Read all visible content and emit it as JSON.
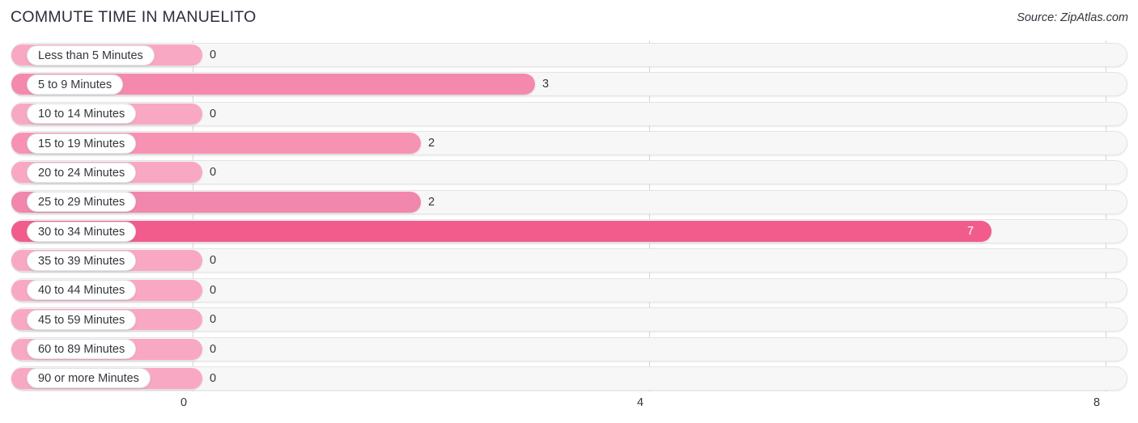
{
  "header": {
    "title": "COMMUTE TIME IN MANUELITO",
    "source": "Source: ZipAtlas.com"
  },
  "chart_data": {
    "type": "bar",
    "orientation": "horizontal",
    "title": "COMMUTE TIME IN MANUELITO",
    "xlabel": "",
    "ylabel": "",
    "xlim": [
      0,
      8
    ],
    "ticks": [
      "0",
      "4",
      "8"
    ],
    "tick_values": [
      0,
      4,
      8
    ],
    "grid": true,
    "legend": false,
    "categories": [
      "Less than 5 Minutes",
      "5 to 9 Minutes",
      "10 to 14 Minutes",
      "15 to 19 Minutes",
      "20 to 24 Minutes",
      "25 to 29 Minutes",
      "30 to 34 Minutes",
      "35 to 39 Minutes",
      "40 to 44 Minutes",
      "45 to 59 Minutes",
      "60 to 89 Minutes",
      "90 or more Minutes"
    ],
    "values": [
      0,
      3,
      0,
      2,
      0,
      2,
      7,
      0,
      0,
      0,
      0,
      0
    ],
    "value_labels": [
      "0",
      "3",
      "0",
      "2",
      "0",
      "2",
      "7",
      "0",
      "0",
      "0",
      "0",
      "0"
    ],
    "colors": [
      "#F9A8C4",
      "#F589AD",
      "#F9A8C4",
      "#F792B3",
      "#F9A8C4",
      "#F187AC",
      "#F15C8D",
      "#F9A8C4",
      "#F9A8C4",
      "#F9A8C4",
      "#F9A8C4",
      "#F9A8C4"
    ],
    "track_color": "#F7F7F7",
    "gridline_color": "#D6D6D8"
  }
}
